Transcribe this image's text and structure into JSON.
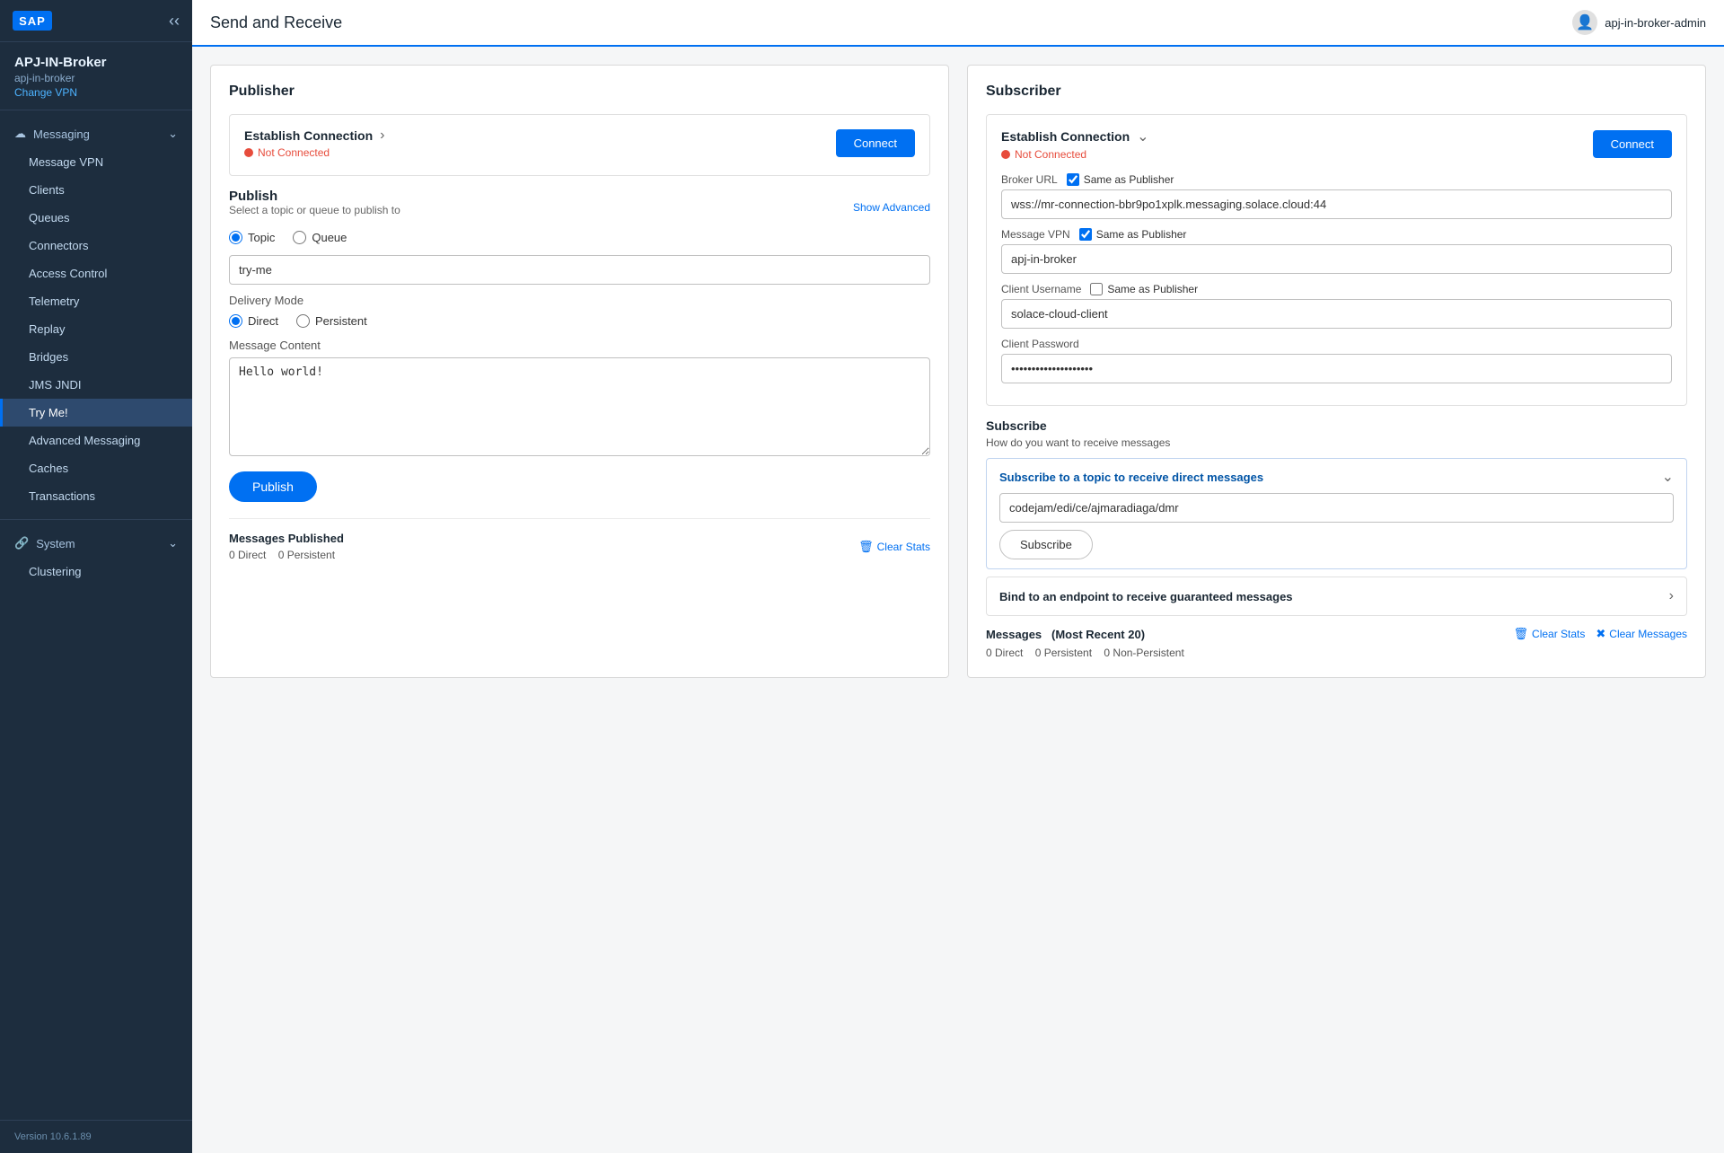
{
  "sidebar": {
    "logo": "SAP",
    "broker": {
      "name": "APJ-IN-Broker",
      "sub": "apj-in-broker",
      "changeVPN": "Change VPN"
    },
    "messaging": {
      "groupLabel": "Messaging",
      "items": [
        {
          "id": "message-vpn",
          "label": "Message VPN"
        },
        {
          "id": "clients",
          "label": "Clients"
        },
        {
          "id": "queues",
          "label": "Queues"
        },
        {
          "id": "connectors",
          "label": "Connectors"
        },
        {
          "id": "access-control",
          "label": "Access Control"
        },
        {
          "id": "telemetry",
          "label": "Telemetry"
        },
        {
          "id": "replay",
          "label": "Replay"
        },
        {
          "id": "bridges",
          "label": "Bridges"
        },
        {
          "id": "jms-jndi",
          "label": "JMS JNDI"
        },
        {
          "id": "try-me",
          "label": "Try Me!",
          "active": true
        },
        {
          "id": "advanced-messaging",
          "label": "Advanced Messaging"
        },
        {
          "id": "caches",
          "label": "Caches"
        },
        {
          "id": "transactions",
          "label": "Transactions"
        }
      ]
    },
    "system": {
      "groupLabel": "System",
      "items": [
        {
          "id": "clustering",
          "label": "Clustering"
        }
      ]
    },
    "version": "Version 10.6.1.89"
  },
  "topbar": {
    "title": "Send and Receive",
    "user": "apj-in-broker-admin"
  },
  "publisher": {
    "panelTitle": "Publisher",
    "connection": {
      "title": "Establish Connection",
      "status": "Not Connected",
      "btnLabel": "Connect"
    },
    "publish": {
      "title": "Publish",
      "subtitle": "Select a topic or queue to publish to",
      "showAdvanced": "Show Advanced",
      "topicLabel": "Topic",
      "queueLabel": "Queue",
      "topicValue": "try-me",
      "deliveryMode": "Delivery Mode",
      "directLabel": "Direct",
      "persistentLabel": "Persistent",
      "messageContentLabel": "Message Content",
      "messageContent": "Hello world!",
      "publishBtn": "Publish"
    },
    "stats": {
      "title": "Messages Published",
      "direct": "0 Direct",
      "persistent": "0 Persistent",
      "clearStats": "Clear Stats"
    }
  },
  "subscriber": {
    "panelTitle": "Subscriber",
    "connection": {
      "title": "Establish Connection",
      "status": "Not Connected",
      "btnLabel": "Connect"
    },
    "fields": {
      "brokerUrl": {
        "label": "Broker URL",
        "sameAsPublisher": "Same as Publisher",
        "value": "wss://mr-connection-bbr9po1xplk.messaging.solace.cloud:44"
      },
      "messageVPN": {
        "label": "Message VPN",
        "sameAsPublisher": "Same as Publisher",
        "value": "apj-in-broker"
      },
      "clientUsername": {
        "label": "Client Username",
        "sameAsPublisher": "Same as Publisher",
        "value": "solace-cloud-client"
      },
      "clientPassword": {
        "label": "Client Password",
        "value": "••••••••••••••••••••"
      }
    },
    "subscribe": {
      "title": "Subscribe",
      "subtitle": "How do you want to receive messages",
      "directTitle": "Subscribe to a topic to receive direct messages",
      "topicValue": "codejam/edi/ce/ajmaradiaga/dmr",
      "subscribeBtn": "Subscribe",
      "bindTitle": "Bind to an endpoint to receive guaranteed messages"
    },
    "messages": {
      "title": "Messages",
      "recent": "(Most Recent 20)",
      "direct": "0 Direct",
      "persistent": "0 Persistent",
      "nonPersistent": "0 Non-Persistent",
      "clearStats": "Clear Stats",
      "clearMessages": "Clear Messages"
    }
  }
}
